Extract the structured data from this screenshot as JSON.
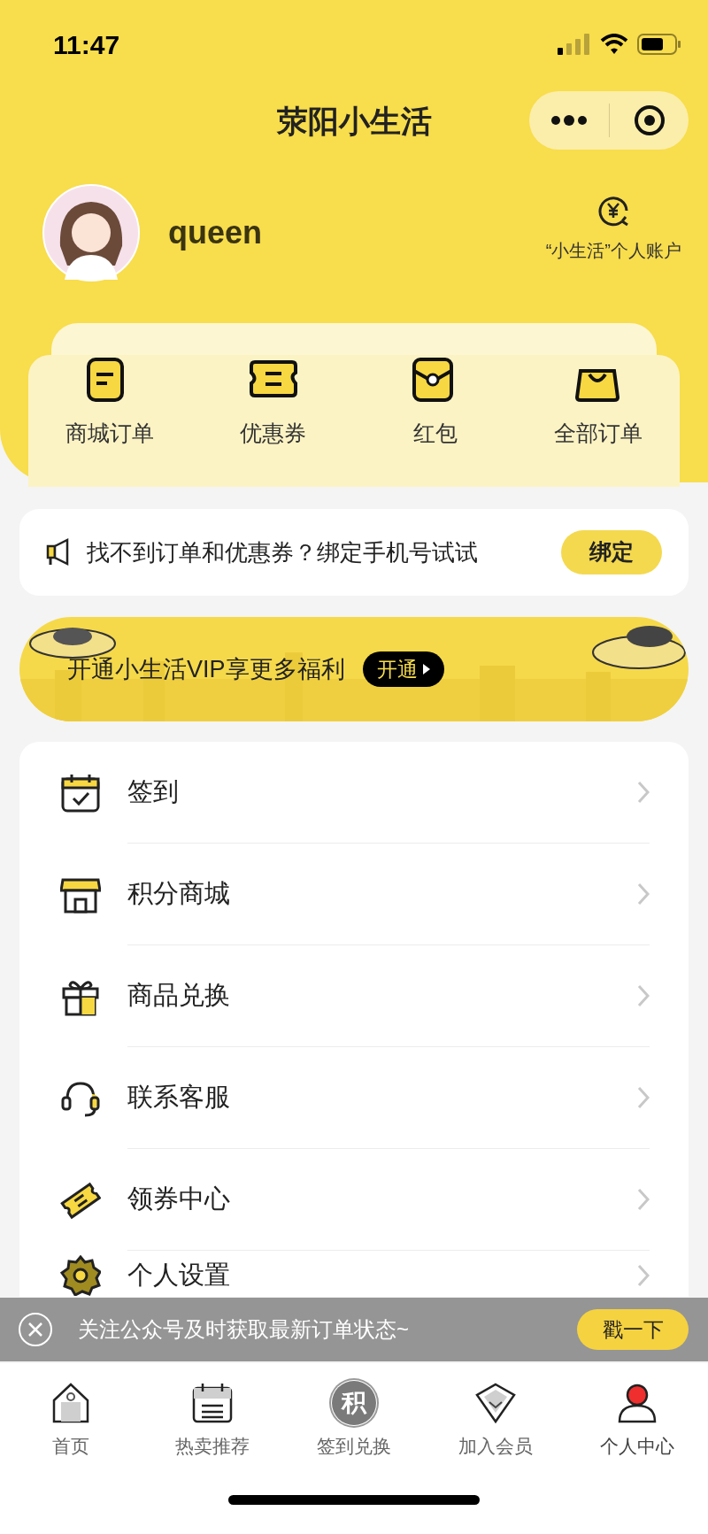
{
  "status_bar": {
    "time": "11:47"
  },
  "header": {
    "title": "荥阳小生活"
  },
  "profile": {
    "username": "queen",
    "account_label": "“小生活”个人账户"
  },
  "order_shortcuts": [
    {
      "label": "商城订单"
    },
    {
      "label": "优惠券"
    },
    {
      "label": "红包"
    },
    {
      "label": "全部订单"
    }
  ],
  "notice": {
    "text": "找不到订单和优惠券？绑定手机号试试",
    "button": "绑定"
  },
  "vip_banner": {
    "text": "开通小生活VIP享更多福利",
    "button": "开通"
  },
  "menu": [
    {
      "label": "签到"
    },
    {
      "label": "积分商城"
    },
    {
      "label": "商品兑换"
    },
    {
      "label": "联系客服"
    },
    {
      "label": "领券中心"
    },
    {
      "label": "个人设置"
    }
  ],
  "follow_bar": {
    "text": "关注公众号及时获取最新订单状态~",
    "button": "戳一下"
  },
  "tab_bar": [
    {
      "label": "首页",
      "selected": false
    },
    {
      "label": "热卖推荐",
      "selected": false
    },
    {
      "label": "签到兑换",
      "selected": false,
      "icon_text": "积"
    },
    {
      "label": "加入会员",
      "selected": false
    },
    {
      "label": "个人中心",
      "selected": true
    }
  ]
}
